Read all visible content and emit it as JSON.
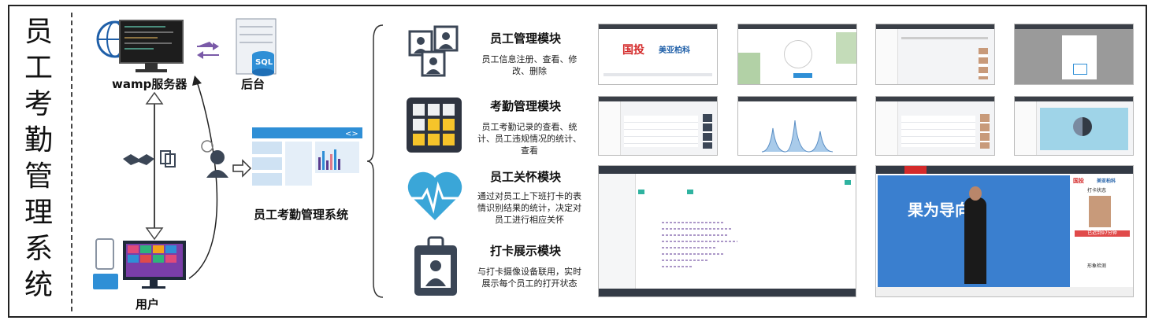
{
  "title_chars": [
    "员",
    "工",
    "考",
    "勤",
    "管",
    "理",
    "系",
    "统"
  ],
  "labels": {
    "server": "wamp服务器",
    "backend": "后台",
    "system": "员工考勤管理系统",
    "user": "用户",
    "sql": "SQL"
  },
  "modules": [
    {
      "title": "员工管理模块",
      "desc": [
        "员工信息注册、查看、修",
        "改、删除"
      ],
      "icon": "employee-cards-icon"
    },
    {
      "title": "考勤管理模块",
      "desc": [
        "员工考勤记录的查看、统",
        "计、员工违规情况的统计、",
        "查看"
      ],
      "icon": "attendance-grid-icon"
    },
    {
      "title": "员工关怀模块",
      "desc": [
        "通过对员工上下班打卡的表",
        "情识别结果的统计，决定对",
        "员工进行相应关怀"
      ],
      "icon": "heart-pulse-icon"
    },
    {
      "title": "打卡展示模块",
      "desc": [
        "与打卡摄像设备联用，实时",
        "展示每个员工的打开状态"
      ],
      "icon": "id-badge-icon"
    }
  ],
  "screens": {
    "login_logo_1": "国投",
    "login_logo_2": "美亚柏科",
    "banner_text": "果为导向",
    "badge_status": "已迟到97分钟",
    "panel_title": "打卡状态",
    "detect_title": "形象检测"
  },
  "colors": {
    "accent": "#2f8fd6",
    "dark": "#333a45",
    "chart_blue": "#7aa7d6"
  }
}
